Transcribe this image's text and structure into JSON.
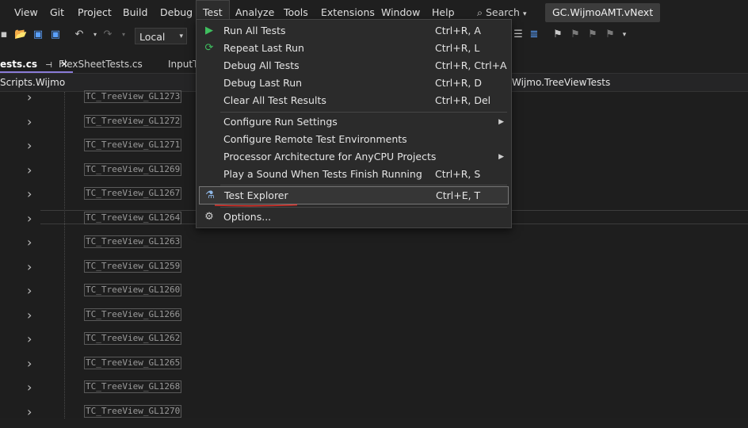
{
  "menubar": {
    "items": [
      "View",
      "Git",
      "Project",
      "Build",
      "Debug",
      "Test",
      "Analyze",
      "Tools",
      "Extensions",
      "Window",
      "Help"
    ],
    "active": "Test",
    "search_label": "Search",
    "solution_name": "GC.WijmoAMT.vNext"
  },
  "toolbar": {
    "config_value": "Local",
    "icons": [
      "new-project-icon",
      "open-folder-icon",
      "save-icon",
      "save-all-icon",
      "undo-icon",
      "redo-icon",
      "format-icon",
      "bookmark-icon",
      "bookmark-prev-icon",
      "bookmark-next-icon",
      "clear-bookmarks-icon",
      "overflow-icon"
    ]
  },
  "tabs": [
    {
      "label": "ests.cs",
      "active": true
    },
    {
      "label": "FlexSheetTests.cs",
      "active": false
    },
    {
      "label": "InputT",
      "active": false
    }
  ],
  "navbar": {
    "left": "Scripts.Wijmo",
    "right": "Wijmo.TreeViewTests"
  },
  "editor": {
    "rows": [
      "TC_TreeView_GL1273",
      "TC_TreeView_GL1272",
      "TC_TreeView_GL1271",
      "TC_TreeView_GL1269",
      "TC_TreeView_GL1267",
      "TC_TreeView_GL1264",
      "TC_TreeView_GL1263",
      "TC_TreeView_GL1259",
      "TC_TreeView_GL1260",
      "TC_TreeView_GL1266",
      "TC_TreeView_GL1262",
      "TC_TreeView_GL1265",
      "TC_TreeView_GL1268",
      "TC_TreeView_GL1270"
    ]
  },
  "test_menu": {
    "items": [
      {
        "label": "Run All Tests",
        "shortcut": "Ctrl+R, A",
        "icon": "play-icon"
      },
      {
        "label": "Repeat Last Run",
        "shortcut": "Ctrl+R, L",
        "icon": "repeat-icon"
      },
      {
        "label": "Debug All Tests",
        "shortcut": "Ctrl+R, Ctrl+A",
        "icon": ""
      },
      {
        "label": "Debug Last Run",
        "shortcut": "Ctrl+R, D",
        "icon": ""
      },
      {
        "label": "Clear All Test Results",
        "shortcut": "Ctrl+R, Del",
        "icon": ""
      },
      {
        "label": "Configure Run Settings",
        "shortcut": "",
        "icon": "",
        "submenu": true
      },
      {
        "label": "Configure Remote Test Environments",
        "shortcut": "",
        "icon": ""
      },
      {
        "label": "Processor Architecture for AnyCPU Projects",
        "shortcut": "",
        "icon": "",
        "submenu": true
      },
      {
        "label": "Play a Sound When Tests Finish Running",
        "shortcut": "Ctrl+R, S",
        "icon": ""
      },
      {
        "label": "Test Explorer",
        "shortcut": "Ctrl+E, T",
        "icon": "test-explorer-icon",
        "highlighted": true
      },
      {
        "label": "Options...",
        "shortcut": "",
        "icon": "gear-icon"
      }
    ]
  },
  "colors": {
    "accent": "#8a7cd8",
    "annotation": "#e0322b",
    "play": "#3fbf5f"
  }
}
